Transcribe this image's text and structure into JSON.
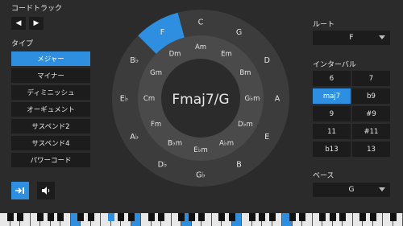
{
  "chord_track": {
    "label": "コードトラック",
    "prev_icon": "chevron-left-icon",
    "next_icon": "chevron-right-icon"
  },
  "type_panel": {
    "label": "タイプ",
    "items": [
      "メジャー",
      "マイナー",
      "ディミニッシュ",
      "オーギュメント",
      "サスペンド2",
      "サスペンド4",
      "パワーコード"
    ],
    "selected": "メジャー"
  },
  "bottom_buttons": {
    "snap_icon": "snap-to-icon",
    "speaker_icon": "speaker-icon"
  },
  "wheel": {
    "center_chord": "Fmaj7/G",
    "outer": [
      "C",
      "G",
      "D",
      "A",
      "E",
      "B",
      "G♭",
      "D♭",
      "A♭",
      "E♭",
      "B♭",
      "F"
    ],
    "middle": [
      "Am",
      "Em",
      "Bm",
      "G♭m",
      "D♭m",
      "A♭m",
      "E♭m",
      "B♭m",
      "Fm",
      "Cm",
      "Gm",
      "Dm"
    ],
    "highlighted_outer": "F"
  },
  "root": {
    "label": "ルート",
    "value": "F"
  },
  "interval": {
    "label": "インターバル",
    "items": [
      "6",
      "7",
      "maj7",
      "b9",
      "9",
      "#9",
      "11",
      "#11",
      "b13",
      "13"
    ],
    "selected": "maj7"
  },
  "bass": {
    "label": "ベース",
    "value": "G"
  },
  "colors": {
    "accent": "#2e8fe0",
    "background": "#2b2b2b",
    "button": "#1c1c1c",
    "wheel_outer": "#3c3c3c",
    "wheel_inner": "#4a4a4a"
  }
}
